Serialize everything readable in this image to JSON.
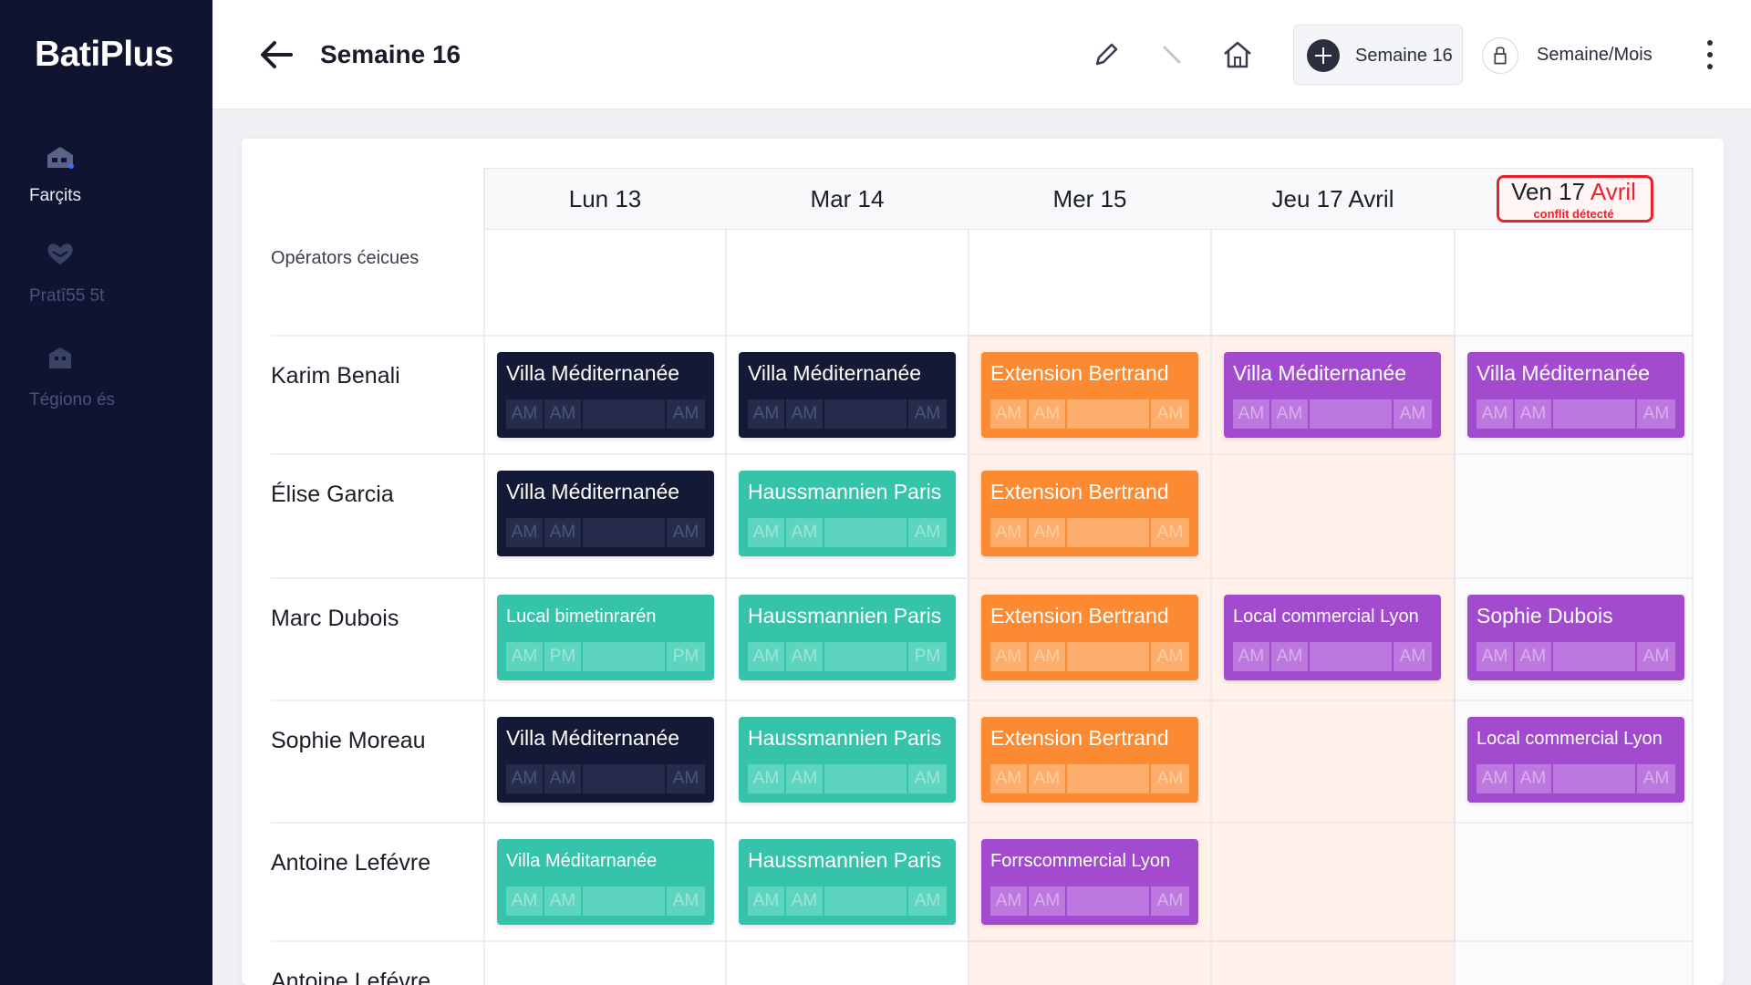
{
  "app": {
    "brand": "BatiPlus"
  },
  "sidebar": {
    "items": [
      {
        "label": "Farçits",
        "icon": "building-icon",
        "active": true
      },
      {
        "label": "Pratî55 5̈t",
        "icon": "heart-hands-icon",
        "active": false
      },
      {
        "label": "Tégiono és",
        "icon": "office-icon",
        "active": false
      }
    ]
  },
  "header": {
    "title": "Semaine 16",
    "week_button": "Semaine 16",
    "view_button": "Semaine/Mois"
  },
  "planning": {
    "operators_label": "Opérators ćeicues",
    "days": [
      {
        "label": "Lun 13"
      },
      {
        "label": "Mar 14"
      },
      {
        "label": "Mer 15"
      },
      {
        "label": "Jeu 17 Avril"
      },
      {
        "label_main": "Ven 17",
        "label_accent": "Avril",
        "conflict_text": "conflit détecté"
      }
    ],
    "rows": [
      {
        "name": "Karim Benali",
        "cells": [
          {
            "project": "Villa Méditernanée",
            "color": "navy",
            "slots": [
              "AM",
              "AM",
              "",
              "AM"
            ]
          },
          {
            "project": "Villa Méditernanée",
            "color": "navy",
            "slots": [
              "AM",
              "AM",
              "",
              "AM"
            ]
          },
          {
            "project": "Extension Bertrand",
            "color": "orange",
            "slots": [
              "AM",
              "AM",
              "",
              "AM"
            ]
          },
          {
            "project": "Villa Méditernanée",
            "color": "purple",
            "slots": [
              "AM",
              "AM",
              "",
              "AM"
            ]
          },
          {
            "project": "Villa Méditernanée",
            "color": "purple",
            "slots": [
              "AM",
              "AM",
              "",
              "AM"
            ]
          }
        ]
      },
      {
        "name": "Élise Garcia",
        "cells": [
          {
            "project": "Villa Méditernanée",
            "color": "navy",
            "slots": [
              "AM",
              "AM",
              "",
              "AM"
            ]
          },
          {
            "project": "Haussmannien Paris",
            "color": "teal",
            "slots": [
              "AM",
              "AM",
              "",
              "AM"
            ]
          },
          {
            "project": "Extension Bertrand",
            "color": "orange",
            "slots": [
              "AM",
              "AM",
              "",
              "AM"
            ]
          },
          null,
          null
        ]
      },
      {
        "name": "Marc Dubois",
        "cells": [
          {
            "project": "Lucal bimetinrarén",
            "color": "teal",
            "small": true,
            "slots": [
              "AM",
              "PM",
              "",
              "PM"
            ]
          },
          {
            "project": "Haussmannien Paris",
            "color": "teal",
            "slots": [
              "AM",
              "AM",
              "",
              "PM"
            ]
          },
          {
            "project": "Extension Bertrand",
            "color": "orange",
            "slots": [
              "AM",
              "AM",
              "",
              "AM"
            ]
          },
          {
            "project": "Local commercial Lyon",
            "color": "purple",
            "small": true,
            "slots": [
              "AM",
              "AM",
              "",
              "AM"
            ]
          },
          {
            "project": "Sophie Dubois",
            "color": "purple",
            "slots": [
              "AM",
              "AM",
              "",
              "AM"
            ]
          }
        ]
      },
      {
        "name": "Sophie Moreau",
        "cells": [
          {
            "project": "Villa Méditernanée",
            "color": "navy",
            "slots": [
              "AM",
              "AM",
              "",
              "AM"
            ]
          },
          {
            "project": "Haussmannien Paris",
            "color": "teal",
            "slots": [
              "AM",
              "AM",
              "",
              "AM"
            ]
          },
          {
            "project": "Extension Bertrand",
            "color": "orange",
            "slots": [
              "AM",
              "AM",
              "",
              "AM"
            ]
          },
          null,
          {
            "project": "Local commercial Lyon",
            "color": "purple",
            "small": true,
            "slots": [
              "AM",
              "AM",
              "",
              "AM"
            ]
          }
        ]
      },
      {
        "name": "Antoine Lefévre",
        "cells": [
          {
            "project": "Villa Méditarnanée",
            "color": "teal",
            "small": true,
            "slots": [
              "AM",
              "AM",
              "",
              "AM"
            ]
          },
          {
            "project": "Haussmannien Paris",
            "color": "teal",
            "slots": [
              "AM",
              "AM",
              "",
              "AM"
            ]
          },
          {
            "project": "Forrscommercial Lyon",
            "color": "purple",
            "small": true,
            "slots": [
              "AM",
              "AM",
              "",
              "AM"
            ]
          },
          null,
          null
        ]
      },
      {
        "name": "Antoine Lefévre",
        "cells": [
          null,
          null,
          null,
          null,
          null
        ]
      }
    ]
  },
  "colors": {
    "sidebar_bg": "#0f1530",
    "navy": "#141a36",
    "teal": "#35c3a9",
    "orange": "#fb8a32",
    "purple": "#a24bce",
    "conflict": "#e8232e"
  }
}
